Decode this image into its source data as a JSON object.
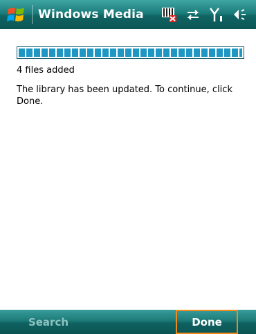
{
  "titlebar": {
    "title": "Windows Media",
    "start_icon": "windows-flag-icon",
    "status_icons": [
      "no-sim-icon",
      "connectivity-icon",
      "signal-icon",
      "speaker-icon"
    ]
  },
  "content": {
    "progress_fraction": 1.0,
    "status_text": "4 files added",
    "message": "The library has been updated. To continue, click Done."
  },
  "menubar": {
    "left_softkey": "Search",
    "right_softkey": "Done"
  },
  "colors": {
    "titlebar": "#1c7d7b",
    "progress": "#1f97c5",
    "focus_outline": "#f08a1a"
  }
}
